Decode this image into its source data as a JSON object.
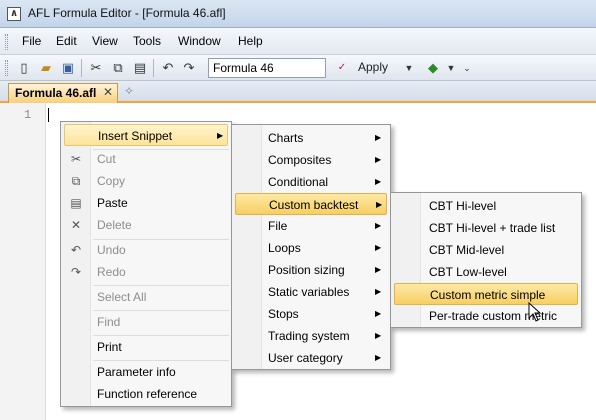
{
  "window": {
    "title": "AFL Formula Editor - [Formula 46.afl]",
    "icon_glyph": "∧"
  },
  "menubar": {
    "items": [
      "File",
      "Edit",
      "View",
      "Tools",
      "Window",
      "Help"
    ]
  },
  "toolbar": {
    "formula_name_value": "Formula 46",
    "apply_label": "Apply",
    "icons": [
      "new-icon",
      "open-icon",
      "save-icon",
      "cut-icon",
      "copy-icon",
      "paste-icon",
      "undo-icon",
      "redo-icon",
      "afl-verify-icon",
      "apply-icon",
      "chart-icon",
      "more-icon"
    ]
  },
  "tab": {
    "label": "Formula 46.afl",
    "close_glyph": "✕",
    "new_glyph": "✧"
  },
  "editor": {
    "line_number": "1"
  },
  "context_menu": {
    "insert_snippet": "Insert Snippet",
    "cut": "Cut",
    "copy": "Copy",
    "paste": "Paste",
    "delete": "Delete",
    "undo": "Undo",
    "redo": "Redo",
    "select_all": "Select All",
    "find": "Find",
    "print": "Print",
    "parameter_info": "Parameter info",
    "function_reference": "Function reference"
  },
  "snippet_menu": {
    "items": [
      "Charts",
      "Composites",
      "Conditional",
      "Custom backtest",
      "File",
      "Loops",
      "Position sizing",
      "Static variables",
      "Stops",
      "Trading system",
      "User category"
    ]
  },
  "backtest_menu": {
    "items": [
      "CBT Hi-level",
      "CBT Hi-level + trade list",
      "CBT Mid-level",
      "CBT Low-level",
      "Custom metric simple",
      "Per-trade custom metric"
    ]
  },
  "colors": {
    "highlight": "#f6cf62",
    "tab_accent": "#f0a63a",
    "menu_bg": "#f7f7f7"
  }
}
